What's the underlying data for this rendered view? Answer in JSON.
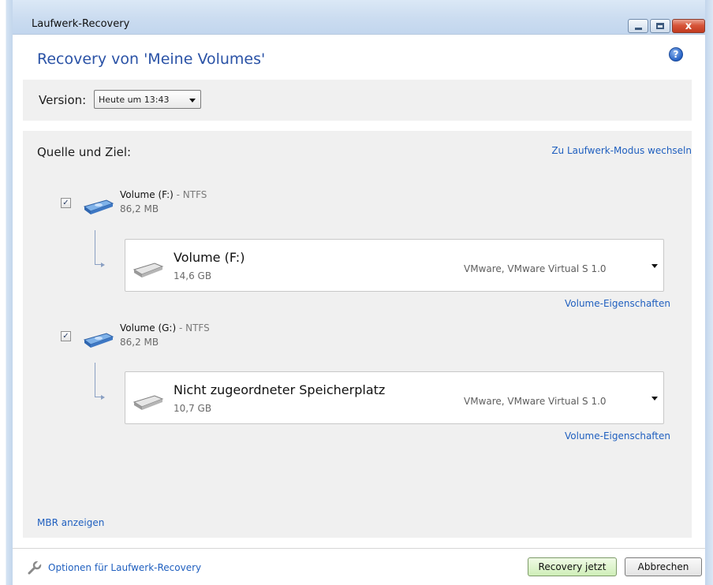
{
  "window": {
    "title": "Laufwerk-Recovery",
    "close_glyph": "x"
  },
  "header": {
    "title": "Recovery von 'Meine Volumes'",
    "help_glyph": "?"
  },
  "version": {
    "label": "Version:",
    "selected": "Heute um 13:43"
  },
  "mapping": {
    "title": "Quelle und Ziel:",
    "mode_link": "Zu Laufwerk-Modus wechseln",
    "entries": [
      {
        "source_name": "Volume (F:)",
        "source_fs": " - NTFS",
        "source_size": "86,2 MB",
        "checked": true,
        "target_name": "Volume (F:)",
        "target_size": "14,6 GB",
        "target_device": "VMware, VMware Virtual S 1.0",
        "props_link": "Volume-Eigenschaften"
      },
      {
        "source_name": "Volume (G:)",
        "source_fs": " - NTFS",
        "source_size": "86,2 MB",
        "checked": true,
        "target_name": "Nicht zugeordneter Speicherplatz",
        "target_size": "10,7 GB",
        "target_device": "VMware, VMware Virtual S 1.0",
        "props_link": "Volume-Eigenschaften"
      }
    ],
    "mbr_link": "MBR anzeigen"
  },
  "footer": {
    "options_link": "Optionen für Laufwerk-Recovery",
    "recovery_button": "Recovery jetzt",
    "cancel_button": "Abbrechen"
  },
  "colors": {
    "accent": "#2a52a6",
    "link": "#1f5fbf",
    "panel": "#f0f0f0"
  },
  "icons": {
    "check": "✓"
  }
}
